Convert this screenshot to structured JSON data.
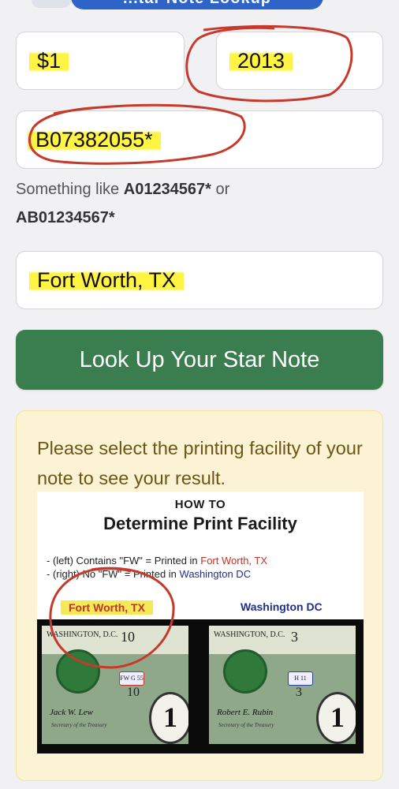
{
  "header": {
    "title_partial": "...tar Note Lookup"
  },
  "form": {
    "denomination": "$1",
    "year": "2013",
    "serial": "B07382055*",
    "serial_hint_prefix": "Something like ",
    "serial_hint_ex1": "A01234567*",
    "serial_hint_mid": " or ",
    "serial_hint_ex2": "AB01234567*",
    "location": "Fort Worth, TX"
  },
  "button": {
    "label": "Look Up Your Star Note"
  },
  "result": {
    "message": "Please select the printing facility of your note to see your result."
  },
  "guide": {
    "title1": "HOW TO",
    "title2": "Determine Print Facility",
    "line1_prefix": "- (left) Contains \"FW\" = Printed in ",
    "line1_place": "Fort Worth, TX",
    "line2_prefix": "- (right) No \"FW\" = Printed in ",
    "line2_place": "Washington DC",
    "label_left": "Fort Worth, TX",
    "label_right": "Washington DC",
    "note_left": {
      "header": "WASHINGTON, D.C.",
      "number": "10",
      "mark": "FW G 55"
    },
    "note_right": {
      "header": "WASHINGTON, D.C.",
      "number": "3",
      "mark": "H 11"
    },
    "note_denomination": "1"
  },
  "colors": {
    "button": "#3a7d4e",
    "panel": "#fbf3d4",
    "highlight": "#f4ea55",
    "annotation": "#c0342a"
  }
}
